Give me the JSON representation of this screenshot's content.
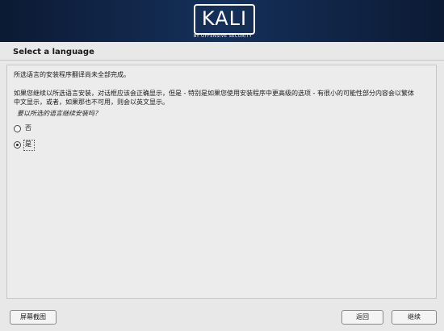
{
  "header": {
    "logo_text": "KALI",
    "logo_tagline": "BY OFFENSIVE SECURITY"
  },
  "page": {
    "title": "Select a language"
  },
  "content": {
    "notice": "所选语言的安装程序翻译尚未全部完成。",
    "paragraph_line1": "如果您继续以所选语言安装，对话框应该会正确显示，但是 - 特别是如果您使用安装程序中更高级的选项 - 有很小的可能性部分内容会以繁体",
    "paragraph_line2": "中文显示，或者，如果那也不可用，则会以英文显示。",
    "question": "要以所选的语言继续安装吗？"
  },
  "options": [
    {
      "label": "否",
      "selected": false
    },
    {
      "label": "是",
      "selected": true
    }
  ],
  "buttons": {
    "screenshot": "屏幕截图",
    "back": "返回",
    "continue": "继续"
  }
}
